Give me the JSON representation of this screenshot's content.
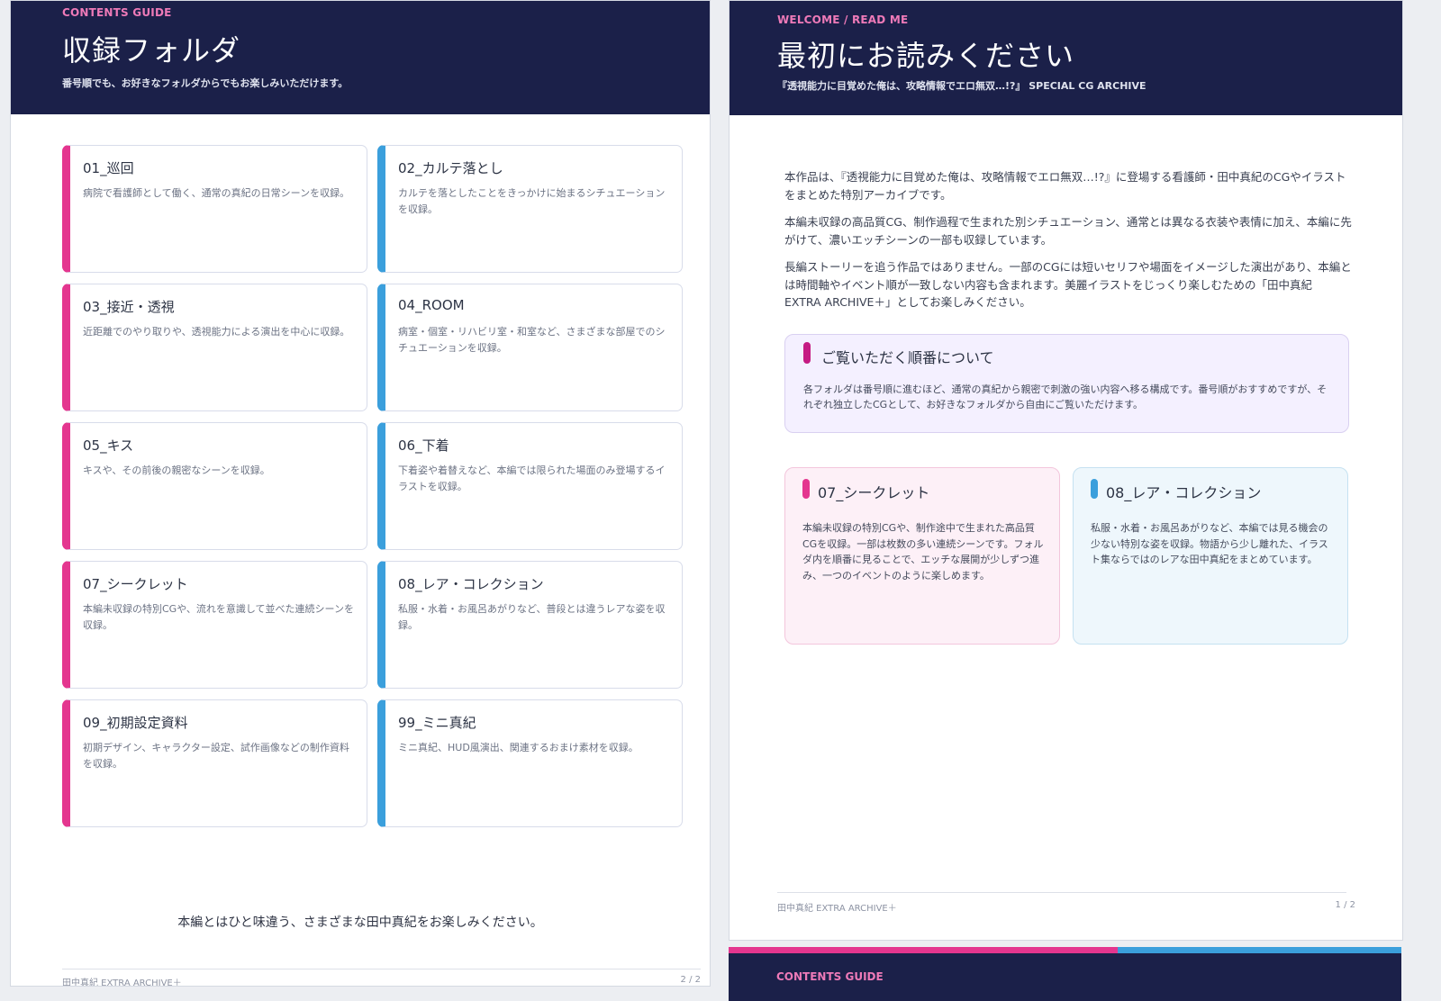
{
  "left_page": {
    "eyebrow": "CONTENTS GUIDE",
    "title": "収録フォルダ",
    "subtitle": "番号順でも、お好きなフォルダからでもお楽しみいただけます。",
    "folders": [
      {
        "name": "01_巡回",
        "desc": "病院で看護師として働く、通常の真紀の日常シーンを収録。",
        "accent": "pink"
      },
      {
        "name": "02_カルテ落とし",
        "desc": "カルテを落としたことをきっかけに始まるシチュエーションを収録。",
        "accent": "blue"
      },
      {
        "name": "03_接近・透視",
        "desc": "近距離でのやり取りや、透視能力による演出を中心に収録。",
        "accent": "pink"
      },
      {
        "name": "04_ROOM",
        "desc": "病室・個室・リハビリ室・和室など、さまざまな部屋でのシチュエーションを収録。",
        "accent": "blue"
      },
      {
        "name": "05_キス",
        "desc": "キスや、その前後の親密なシーンを収録。",
        "accent": "pink"
      },
      {
        "name": "06_下着",
        "desc": "下着姿や着替えなど、本編では限られた場面のみ登場するイラストを収録。",
        "accent": "blue"
      },
      {
        "name": "07_シークレット",
        "desc": "本編未収録の特別CGや、流れを意識して並べた連続シーンを収録。",
        "accent": "pink"
      },
      {
        "name": "08_レア・コレクション",
        "desc": "私服・水着・お風呂あがりなど、普段とは違うレアな姿を収録。",
        "accent": "blue"
      },
      {
        "name": "09_初期設定資料",
        "desc": "初期デザイン、キャラクター設定、試作画像などの制作資料を収録。",
        "accent": "pink"
      },
      {
        "name": "99_ミニ真紀",
        "desc": "ミニ真紀、HUD風演出、関連するおまけ素材を収録。",
        "accent": "blue"
      }
    ],
    "closing": "本編とはひと味違う、さまざまな田中真紀をお楽しみください。",
    "footer_left": "田中真紀 EXTRA ARCHIVE＋",
    "footer_right": "2 / 2"
  },
  "right_page": {
    "eyebrow": "WELCOME / READ ME",
    "title": "最初にお読みください",
    "subtitle": "『透視能力に目覚めた俺は、攻略情報でエロ無双…!?』 SPECIAL CG ARCHIVE",
    "intro": [
      "本作品は、『透視能力に目覚めた俺は、攻略情報でエロ無双…!?』に登場する看護師・田中真紀のCGやイラストをまとめた特別アーカイブです。",
      "本編未収録の高品質CG、制作過程で生まれた別シチュエーション、通常とは異なる衣装や表情に加え、本編に先がけて、濃いエッチシーンの一部も収録しています。",
      "長編ストーリーを追う作品ではありません。一部のCGには短いセリフや場面をイメージした演出があり、本編とは時間軸やイベント順が一致しない内容も含まれます。美麗イラストをじっくり楽しむための「田中真紀 EXTRA ARCHIVE＋」としてお楽しみください。"
    ],
    "note": {
      "title": "ご覧いただく順番について",
      "body": "各フォルダは番号順に進むほど、通常の真紀から親密で刺激の強い内容へ移る構成です。番号順がおすすめですが、それぞれ独立したCGとして、お好きなフォルダから自由にご覧いただけます。"
    },
    "features": [
      {
        "title": "07_シークレット",
        "body": "本編未収録の特別CGや、制作途中で生まれた高品質CGを収録。一部は枚数の多い連続シーンです。フォルダ内を順番に見ることで、エッチな展開が少しずつ進み、一つのイベントのように楽しめます。"
      },
      {
        "title": "08_レア・コレクション",
        "body": "私服・水着・お風呂あがりなど、本編では見る機会の少ない特別な姿を収録。物語から少し離れた、イラスト集ならではのレアな田中真紀をまとめています。"
      }
    ],
    "footer_left": "田中真紀 EXTRA ARCHIVE＋",
    "footer_right": "1 / 2"
  },
  "next_page": {
    "eyebrow": "CONTENTS GUIDE"
  },
  "colors": {
    "header_navy": "#1b2049",
    "accent_pink": "#e4368f",
    "accent_blue": "#3b9fdc",
    "eyebrow_pink": "#ee7ab8"
  }
}
